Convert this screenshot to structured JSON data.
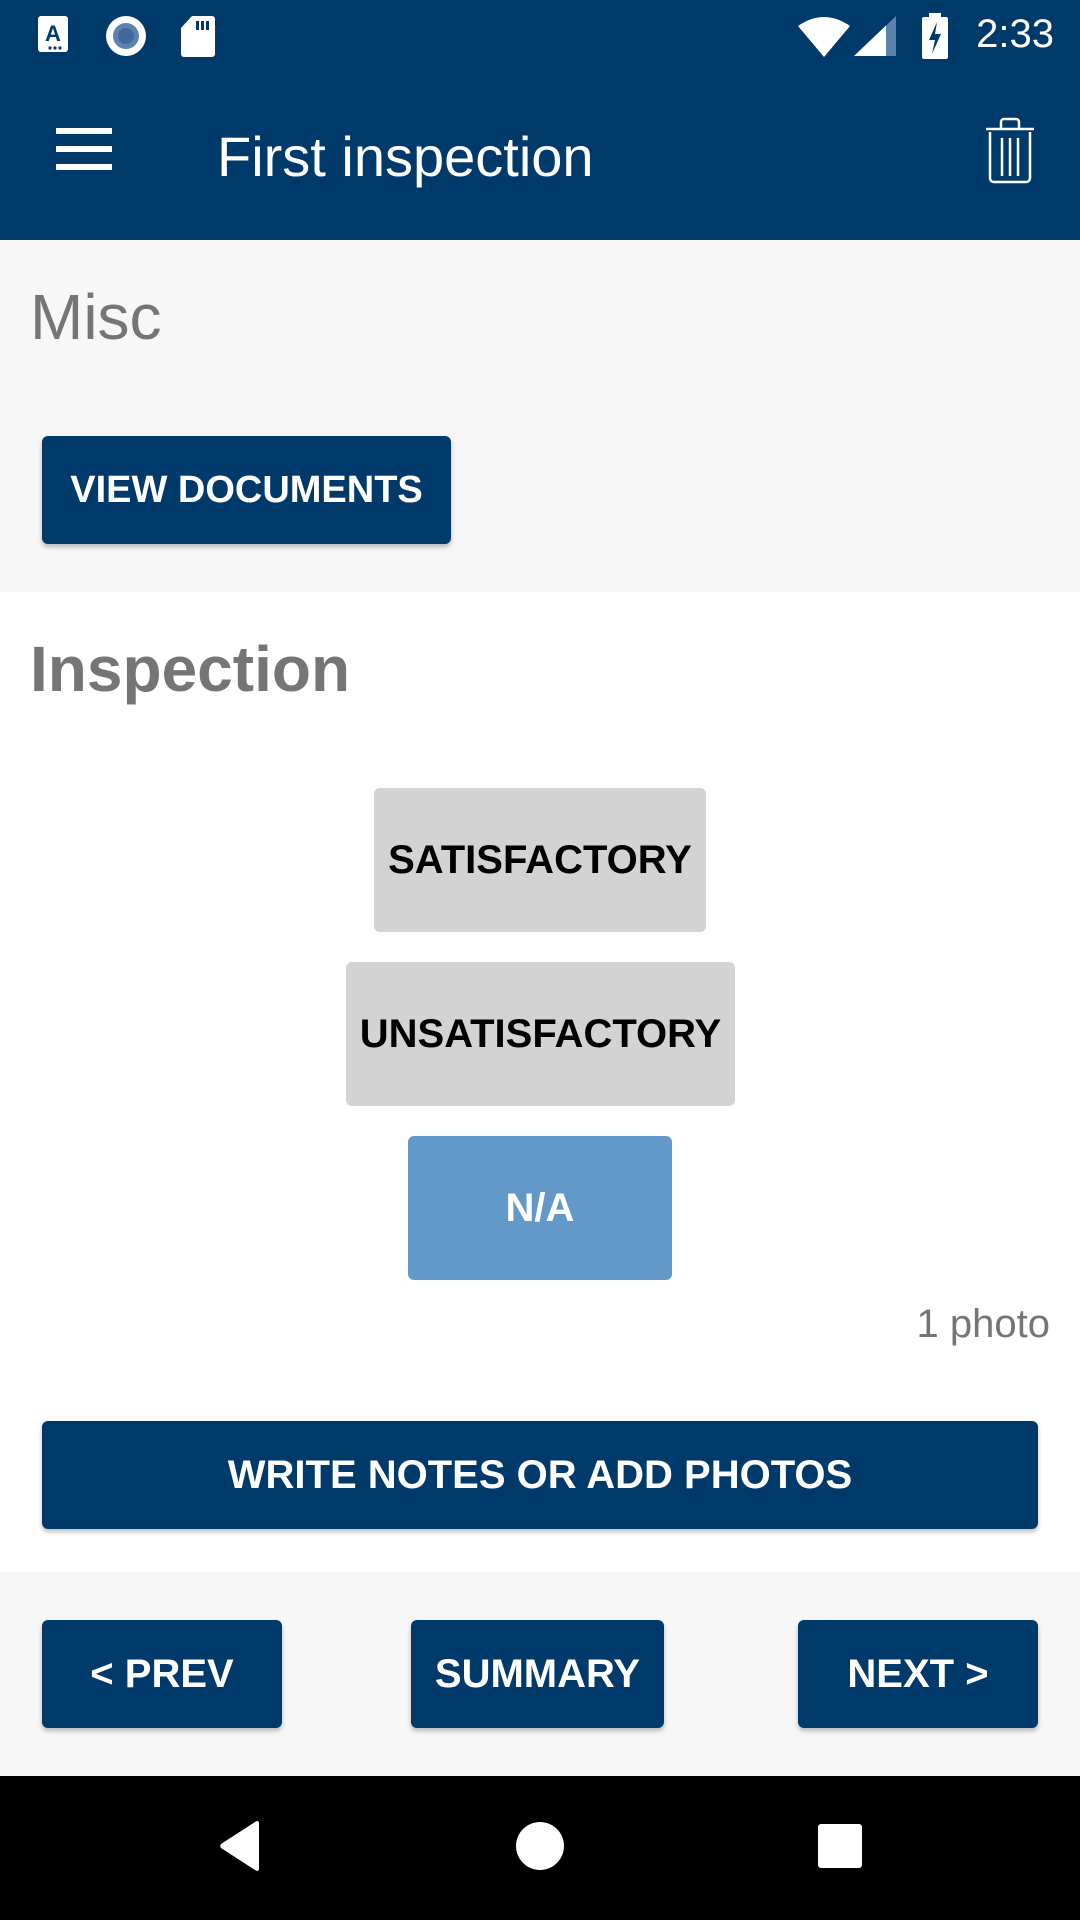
{
  "status_bar": {
    "time": "2:33",
    "left_icons": [
      "text-accessibility-icon",
      "record-icon",
      "sd-card-icon"
    ],
    "right_icons": [
      "wifi-icon",
      "cellular-signal-icon",
      "battery-charging-icon"
    ]
  },
  "app_bar": {
    "title": "First inspection",
    "menu_icon": "hamburger-menu-icon",
    "delete_icon": "trash-icon"
  },
  "misc_section": {
    "title": "Misc",
    "view_documents_label": "VIEW DOCUMENTS"
  },
  "inspection_section": {
    "title": "Inspection",
    "options": [
      {
        "label": "SATISFACTORY",
        "selected": false
      },
      {
        "label": "UNSATISFACTORY",
        "selected": false
      },
      {
        "label": "N/A",
        "selected": true
      }
    ],
    "photo_count": "1 photo",
    "write_notes_label": "WRITE NOTES OR ADD PHOTOS"
  },
  "nav_footer": {
    "prev_label": "< PREV",
    "summary_label": "SUMMARY",
    "next_label": "NEXT >"
  },
  "system_nav": {
    "back_icon": "back-triangle-icon",
    "home_icon": "home-circle-icon",
    "recents_icon": "recents-square-icon"
  },
  "colors": {
    "primary": "#003A6B",
    "selected_option": "#6399C8",
    "unselected_option": "#D3D3D3",
    "section_gray": "#F7F7F7",
    "heading_text": "#757575"
  }
}
